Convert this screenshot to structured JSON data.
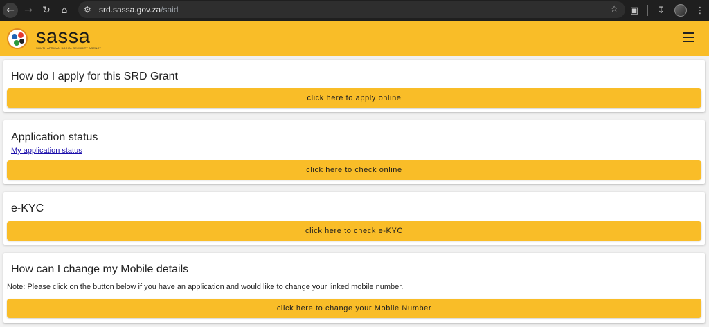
{
  "browser": {
    "url_host": "srd.sassa.gov.za",
    "url_path": "/said"
  },
  "header": {
    "logo_word": "sassa",
    "logo_sub": "SOUTH AFRICAN SOCIAL SECURITY AGENCY"
  },
  "cards": [
    {
      "title": "How do I apply for this SRD Grant",
      "button": "click here to apply online"
    },
    {
      "title": "Application status",
      "link": "My application status",
      "button": "click here to check online"
    },
    {
      "title": "e-KYC",
      "button": "click here to check e-KYC"
    },
    {
      "title": "How can I change my Mobile details",
      "note": "Note: Please click on the button below if you have an application and would like to change your linked mobile number.",
      "button": "click here to change your Mobile Number"
    }
  ],
  "colors": {
    "brand_yellow": "#f9bd28",
    "chrome_dark": "#1f1f1f",
    "link_blue": "#1a0dab"
  },
  "icons": [
    "back-icon",
    "forward-icon",
    "reload-icon",
    "home-icon",
    "site-settings-icon",
    "star-icon",
    "extensions-icon",
    "download-icon",
    "more-icon",
    "hamburger-menu-icon"
  ]
}
